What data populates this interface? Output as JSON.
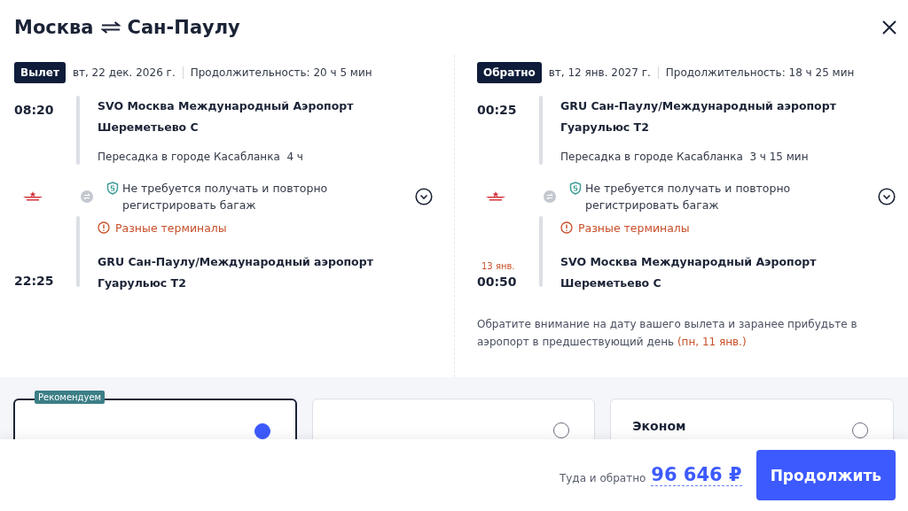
{
  "title": {
    "from": "Москва",
    "to": "Сан-Паулу"
  },
  "legs": [
    {
      "badge": "Вылет",
      "date": "вт, 22 дек. 2026 г.",
      "duration": "Продолжительность: 20 ч 5 мин",
      "departure": {
        "time": "08:20",
        "airport": "SVO Москва Международный Аэропорт Шереметьево C"
      },
      "transfer": {
        "text": "Пересадка в городе Касабланка",
        "duration": "4 ч",
        "baggage": "Не требуется получать и повторно регистрировать багаж",
        "warning": "Разные терминалы"
      },
      "arrival": {
        "time": "22:25",
        "airport": "GRU Сан-Паулу/Международный аэропорт Гуарульюс T2"
      }
    },
    {
      "badge": "Обратно",
      "date": "вт, 12 янв. 2027 г.",
      "duration": "Продолжительность: 18 ч 25 мин",
      "departure": {
        "time": "00:25",
        "airport": "GRU Сан-Паулу/Международный аэропорт Гуарульюс T2"
      },
      "transfer": {
        "text": "Пересадка в городе Касабланка",
        "duration": "3 ч 15 мин",
        "baggage": "Не требуется получать и повторно регистрировать багаж",
        "warning": "Разные терминалы"
      },
      "arrival": {
        "date_note": "13 янв.",
        "time": "00:50",
        "airport": "SVO Москва Международный Аэропорт Шереметьево C"
      },
      "note": {
        "text": "Обратите внимание на дату вашего вылета и заранее прибудьте в аэропорт в предшествующий день",
        "highlight": "(пн, 11 янв.)"
      }
    }
  ],
  "fares": [
    {
      "badge": "Рекомендуем",
      "selected": true
    },
    {
      "selected": false
    },
    {
      "name": "Эконом",
      "selected": false
    }
  ],
  "footer": {
    "label": "Туда и обратно",
    "price": "96 646 ₽",
    "button": "Продолжить"
  }
}
